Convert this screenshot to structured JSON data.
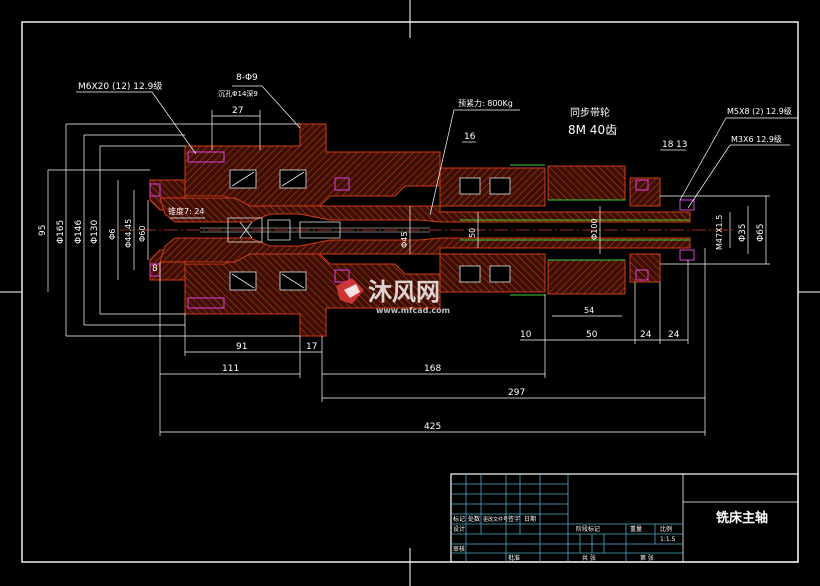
{
  "title_block": {
    "drawing_title": "铣床主轴",
    "scale": "1:1.5",
    "labels": {
      "mark": "标记",
      "count": "处数",
      "file_no": "更改文件号",
      "sign": "签字",
      "date": "日期",
      "design": "设计",
      "review": "审核",
      "approve": "批准",
      "stage_mark": "阶段标记",
      "weight": "重量",
      "scale": "比例",
      "sheet": "共 张",
      "sheet2": "第 张"
    }
  },
  "annotations": {
    "thread_m6": "M6X20 (12) 12.9级",
    "holes": "8-Φ9",
    "counterbore": "沉孔Φ14深9",
    "preload": "预紧力: 800Kg",
    "pulley_title": "同步带轮",
    "pulley_spec": "8M   40齿",
    "thread_m5": "M5X8 (2) 12.9级",
    "thread_m3": "M3X6  12.9级",
    "taper": "锥度7: 24",
    "thread_m47": "M47X1.5"
  },
  "dimensions": {
    "h_27": "27",
    "h_16": "16",
    "h_18": "18",
    "h_13": "13",
    "h_91": "91",
    "h_17": "17",
    "h_111": "111",
    "h_168": "168",
    "h_297": "297",
    "h_425": "425",
    "h_10": "10",
    "h_50": "50",
    "h_24a": "24",
    "h_24b": "24",
    "h_8": "8",
    "h_54": "54",
    "v_95": "95",
    "v_165": "Φ165",
    "v_146": "Φ146",
    "v_130": "Φ130",
    "v_d6": "Φ6",
    "v_d4465": "Φ44.45",
    "v_d60": "Φ60",
    "v_d45": "Φ45",
    "v_d50": "Φ50",
    "v_d100": "Φ100",
    "v_d35": "Φ35",
    "v_d65": "Φ65",
    "v_50": "50"
  },
  "watermark": {
    "brand": "沐风网",
    "url": "www.mfcad.com"
  },
  "colors": {
    "background": "#000000",
    "frame": "#ffffff",
    "section": "#d23c14",
    "dimension": "#ffffff",
    "leader": "#ffffff",
    "centerline": "#d23c14",
    "table_lines": "#4ab0c8",
    "bearing": "#e8e8e8",
    "green": "#3cd23c",
    "magenta": "#e040e0",
    "watermark": "#e23c3c"
  }
}
